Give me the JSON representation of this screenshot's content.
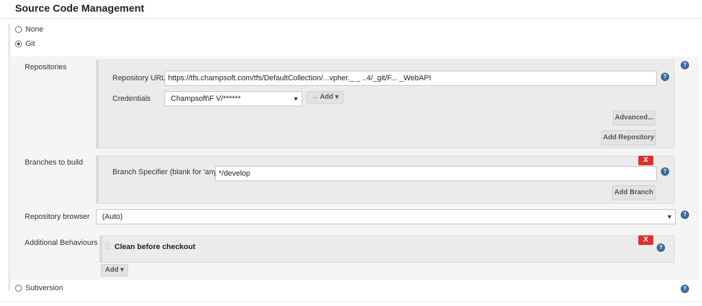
{
  "header": {
    "title": "Source Code Management"
  },
  "scm_options": [
    {
      "label": "None",
      "checked": false
    },
    {
      "label": "Git",
      "checked": true
    },
    {
      "label": "Subversion",
      "checked": false
    }
  ],
  "repositories": {
    "label": "Repositories",
    "url_label": "Repository URL",
    "url_value": "https://tfs.champsoft.com/tfs/DefaultCollection/...vpher._ _ ..4/_git/F...    _WebAPI",
    "credentials_label": "Credentials",
    "credentials_value": "Champsoft\\F     V/******",
    "add_label": "Add",
    "advanced_label": "Advanced...",
    "add_repository_label": "Add Repository"
  },
  "branches": {
    "label": "Branches to build",
    "close_label": "X",
    "specifier_label": "Branch Specifier (blank for 'any')",
    "specifier_value": "*/develop",
    "add_branch_label": "Add Branch"
  },
  "browser": {
    "label": "Repository browser",
    "value": "(Auto)"
  },
  "behaviours": {
    "label": "Additional Behaviours",
    "item_label": "Clean before checkout",
    "close_label": "X",
    "add_label": "Add"
  },
  "help_glyph": "?",
  "icons": {
    "help": "help-icon",
    "dropdown": "chevron-down-icon",
    "key": "key-icon",
    "drag": "drag-handle-icon"
  },
  "colors": {
    "delete": "#d9342b",
    "help": "#3a6ea5",
    "panel": "#ebebeb"
  }
}
